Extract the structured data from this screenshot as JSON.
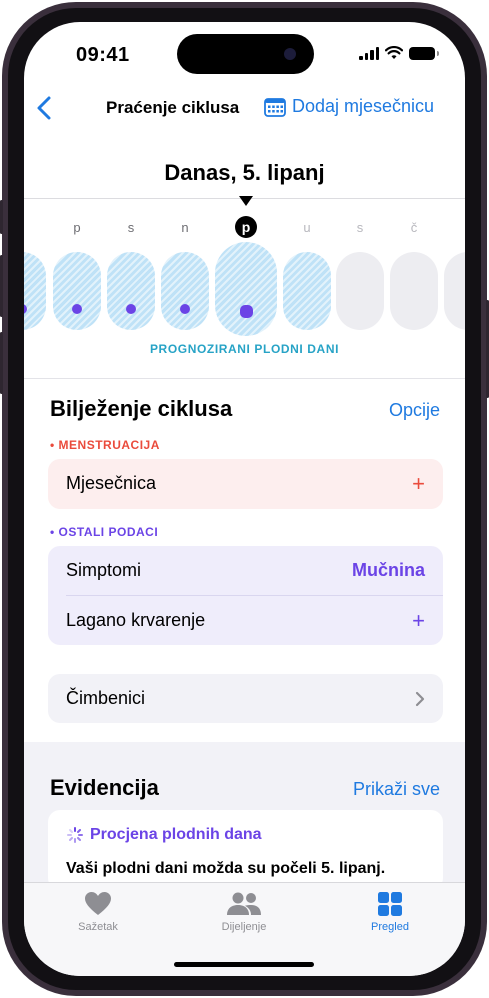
{
  "status_bar": {
    "time": "09:41"
  },
  "nav": {
    "title": "Praćenje ciklusa",
    "add_label": "Dodaj mjesečnicu"
  },
  "calendar": {
    "date_heading": "Danas, 5. lipanj",
    "days": [
      "p",
      "s",
      "n",
      "p",
      "u",
      "s",
      "č"
    ],
    "today_index": 3,
    "fertile_label": "PROGNOZIRANI PLODNI DANI"
  },
  "cycle_log": {
    "title": "Bilježenje ciklusa",
    "options_label": "Opcije",
    "menstruation_category": "• MENSTRUACIJA",
    "period_label": "Mjesečnica",
    "other_category": "• OSTALI PODACI",
    "symptoms_label": "Simptomi",
    "symptoms_value": "Mučnina",
    "spotting_label": "Lagano krvarenje",
    "factors_label": "Čimbenici"
  },
  "records": {
    "title": "Evidencija",
    "show_all": "Prikaži sve",
    "card_title": "Procjena plodnih dana",
    "card_text": "Vaši plodni dani možda su počeli 5. lipanj."
  },
  "tabbar": {
    "summary": "Sažetak",
    "sharing": "Dijeljenje",
    "browse": "Pregled"
  },
  "colors": {
    "accent": "#1f7ae0",
    "fertile": "#27a3c6",
    "purple": "#6b44e6",
    "red": "#ea4b3c"
  }
}
